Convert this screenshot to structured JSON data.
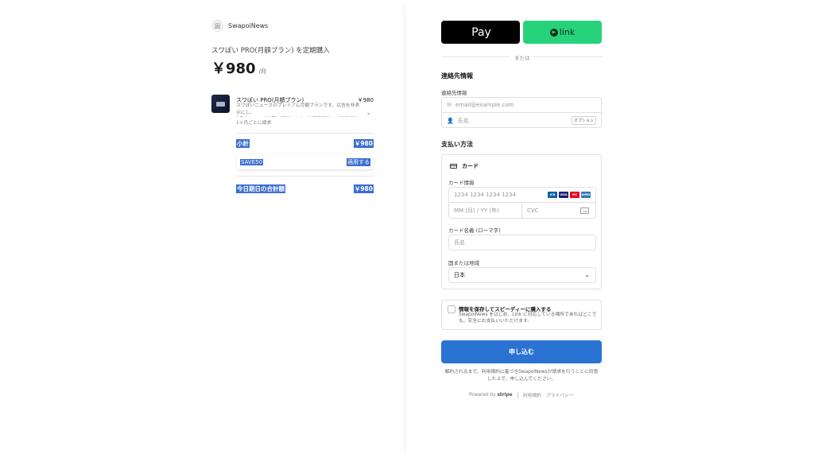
{
  "summary": {
    "merchant_initial": "図",
    "merchant_name": "SwapoiNews",
    "subscribe_title": "スワぽい PRO(月額プラン) を定期購入",
    "price": "￥980",
    "per": "/月",
    "item": {
      "name": "スワぽい PRO(月額プラン)",
      "price": "￥980",
      "description": "スワぽいニュースのプレミアム月額プランです。広告を非表示にし、\n1日のスワイプ上限を解除します。決済完了後すぐ利用できま...",
      "period": "1ヶ月ごとに請求"
    },
    "subtotal_label": "小計",
    "subtotal_value": "￥980",
    "promo_code": "SAVE50",
    "promo_apply": "適用する",
    "total_label": "今日期日の合計額",
    "total_value": "￥980"
  },
  "checkout": {
    "apple_pay_label": "Pay",
    "link_label": "link",
    "or_text": "または",
    "contact_title": "連絡先情報",
    "contact_label": "連絡先情報",
    "email_placeholder": "email@example.com",
    "name_placeholder": "氏名",
    "optional_badge": "オプション",
    "payment_title": "支払い方法",
    "card_tab": "カード",
    "card_info_label": "カード情報",
    "card_number_placeholder": "1234 1234 1234 1234",
    "card_brands": [
      {
        "name": "JCB",
        "color": "#0b5fa5"
      },
      {
        "name": "VISA",
        "color": "#1a1f71"
      },
      {
        "name": "MC",
        "color": "#eb001b"
      },
      {
        "name": "AMEX",
        "color": "#2e77bc"
      }
    ],
    "expiry_placeholder": "MM (月) / YY (年)",
    "cvc_placeholder": "CVC",
    "cvc_icon_text": "135",
    "cardholder_label": "カード名義 (ローマ字)",
    "cardholder_placeholder": "氏名",
    "country_label": "国または地域",
    "country_value": "日本",
    "save_title": "情報を保存してスピーディーに購入する",
    "save_description": "SwapoiNews をはじめ、Link に対応している場所であればどこで\nも、安全にお支払いいただけます。",
    "submit_label": "申し込む",
    "terms": "解約されるまで、利用規約に基づきSwapoiNewsが請求を行うことに同意\nした上で、申し込んでください。",
    "footer_powered": "Powered by",
    "footer_stripe": "stripe",
    "footer_terms": "利用規約",
    "footer_privacy": "プライバシー"
  },
  "colors": {
    "accent": "#2a73d2",
    "link_green": "#26d37a",
    "highlight": "#3b6ed1"
  }
}
